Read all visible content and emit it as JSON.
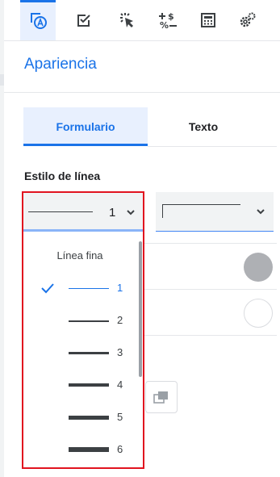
{
  "toolbar": {
    "icons": [
      "appearance-icon",
      "checkbox-icon",
      "click-icon",
      "number-format-icon",
      "calculator-icon",
      "settings-gears-icon"
    ],
    "active_index": 0
  },
  "panel": {
    "title": "Apariencia",
    "tabs": [
      {
        "label": "Formulario",
        "active": true
      },
      {
        "label": "Texto",
        "active": false
      }
    ],
    "line_style_label": "Estilo de línea",
    "line_weight_select": {
      "value": "1"
    },
    "colors": {
      "accent": "#1a73e8",
      "highlight_border": "#e1131f",
      "fill_circle": "#aeb0b4"
    }
  },
  "dropdown": {
    "heading": "Línea fina",
    "options": [
      {
        "label": "1",
        "weight": 1,
        "selected": true
      },
      {
        "label": "2",
        "weight": 2,
        "selected": false
      },
      {
        "label": "3",
        "weight": 3,
        "selected": false
      },
      {
        "label": "4",
        "weight": 4,
        "selected": false
      },
      {
        "label": "5",
        "weight": 5,
        "selected": false
      },
      {
        "label": "6",
        "weight": 6,
        "selected": false
      }
    ]
  }
}
